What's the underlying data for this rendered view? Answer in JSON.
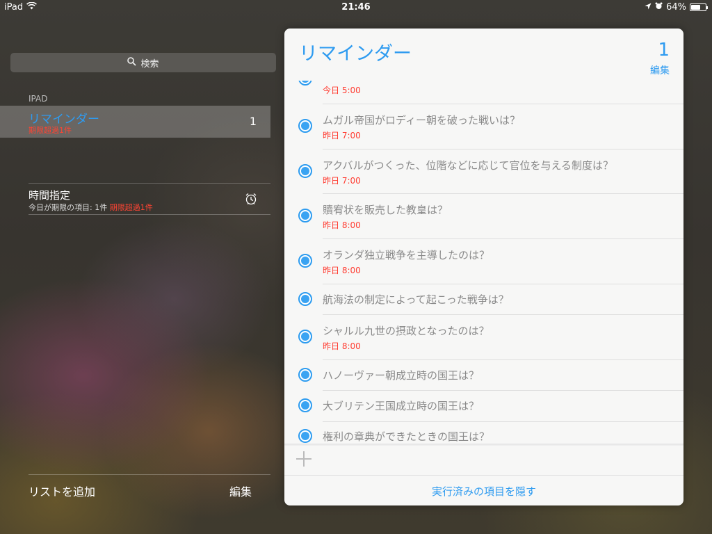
{
  "status_bar": {
    "device": "iPad",
    "time": "21:46",
    "battery": "64%",
    "battery_level": 0.64
  },
  "sidebar": {
    "search_label": "検索",
    "section_header": "IPAD",
    "active_list": {
      "name": "リマインダー",
      "overdue": "期限超過1件",
      "count": "1"
    },
    "scheduled": {
      "name": "時間指定",
      "sub_prefix": "今日が期限の項目: 1件",
      "sub_overdue": "期限超過1件"
    },
    "add_list_label": "リストを追加",
    "edit_label": "編集"
  },
  "panel": {
    "title": "リマインダー",
    "count": "1",
    "edit_label": "編集",
    "items": [
      {
        "title": "",
        "due": "今日 5:00"
      },
      {
        "title": "ムガル帝国がロディー朝を破った戦いは？",
        "due": "昨日 7:00"
      },
      {
        "title": "アクバルがつくった、位階などに応じて官位を与える制度は？",
        "due": "昨日 7:00"
      },
      {
        "title": "贖宥状を販売した教皇は？",
        "due": "昨日 8:00"
      },
      {
        "title": "オランダ独立戦争を主導したのは？",
        "due": "昨日 8:00"
      },
      {
        "title": "航海法の制定によって起こった戦争は？",
        "due": ""
      },
      {
        "title": "シャルル九世の摂政となったのは？",
        "due": "昨日 8:00"
      },
      {
        "title": "ハノーヴァー朝成立時の国王は？",
        "due": ""
      },
      {
        "title": "大ブリテン王国成立時の国王は？",
        "due": ""
      },
      {
        "title": "権利の章典ができたときの国王は？",
        "due": ""
      }
    ],
    "hide_completed_label": "実行済みの項目を隠す"
  }
}
